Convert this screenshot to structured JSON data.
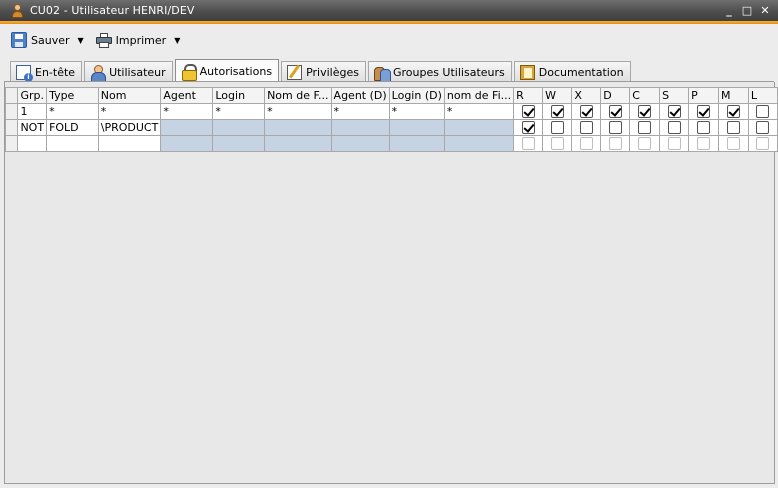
{
  "window": {
    "title": "CU02 - Utilisateur HENRI/DEV",
    "controls": [
      "_",
      "□",
      "✕"
    ]
  },
  "toolbar": {
    "save_label": "Sauver",
    "print_label": "Imprimer"
  },
  "tabs": [
    {
      "label": "En-tête",
      "icon": "document-info-icon"
    },
    {
      "label": "Utilisateur",
      "icon": "user-icon"
    },
    {
      "label": "Autorisations",
      "icon": "lock-icon",
      "active": true
    },
    {
      "label": "Privilèges",
      "icon": "privileges-icon"
    },
    {
      "label": "Groupes Utilisateurs",
      "icon": "user-group-icon"
    },
    {
      "label": "Documentation",
      "icon": "book-icon"
    }
  ],
  "grid": {
    "columns": [
      "Grp.",
      "Type",
      "Nom",
      "Agent",
      "Login",
      "Nom de F...",
      "Agent (D)",
      "Login (D)",
      "nom de Fi...",
      "R",
      "W",
      "X",
      "D",
      "C",
      "S",
      "P",
      "M",
      "L"
    ],
    "rows": [
      {
        "grp": "1",
        "type": "*",
        "nom": "*",
        "agent": "*",
        "login": "*",
        "nomf": "*",
        "agentd": "*",
        "logind": "*",
        "nomfi": "*",
        "flags": [
          true,
          true,
          true,
          true,
          true,
          true,
          true,
          true,
          false
        ]
      },
      {
        "grp": "NOT",
        "type": "FOLD",
        "nom": "\\PRODUCT",
        "agent": "",
        "login": "",
        "nomf": "",
        "agentd": "",
        "logind": "",
        "nomfi": "",
        "flags": [
          true,
          false,
          false,
          false,
          false,
          false,
          false,
          false,
          false
        ]
      },
      {
        "grp": "",
        "type": "",
        "nom": "",
        "agent": "",
        "login": "",
        "nomf": "",
        "agentd": "",
        "logind": "",
        "nomfi": "",
        "flags": [
          false,
          false,
          false,
          false,
          false,
          false,
          false,
          false,
          false
        ]
      }
    ]
  }
}
